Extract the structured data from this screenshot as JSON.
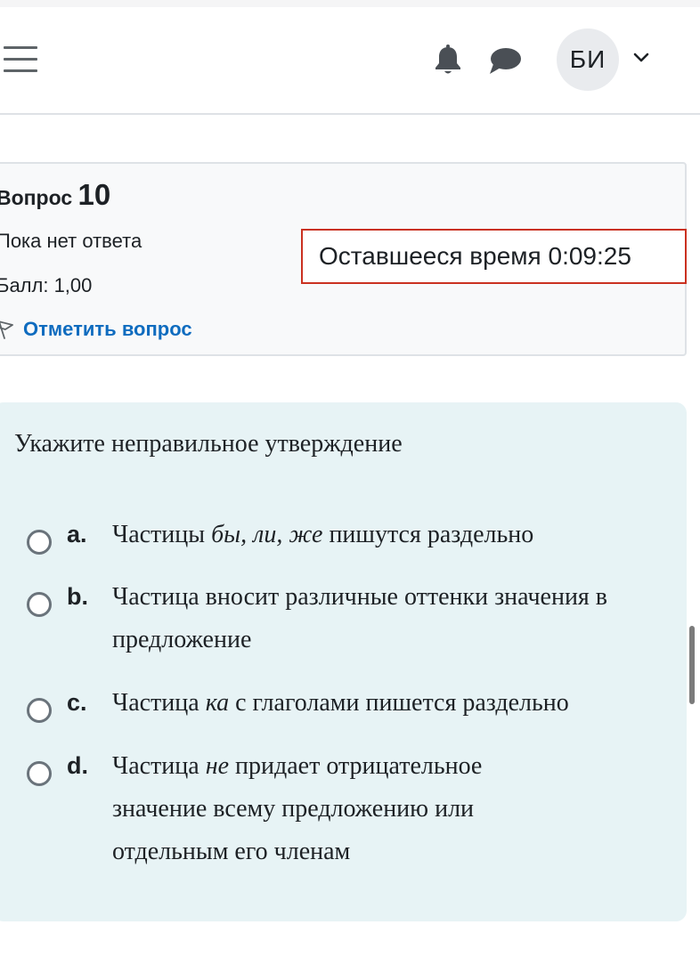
{
  "header": {
    "menu_icon": "hamburger-icon",
    "notifications_icon": "bell-icon",
    "messages_icon": "chat-bubble-icon",
    "user_initials": "БИ",
    "user_menu_icon": "chevron-down-icon"
  },
  "question_info": {
    "title_prefix": "Вопрос",
    "number": "10",
    "status": "Пока нет ответа",
    "grade": "Балл: 1,00",
    "flag_icon": "flag-outline-icon",
    "flag_label": "Отметить вопрос"
  },
  "timer": {
    "label": "Оставшееся время",
    "value": "0:09:25",
    "border_color": "#ca3120"
  },
  "question": {
    "prompt": "Укажите неправильное утверждение",
    "answers": [
      {
        "letter": "a.",
        "text_before": "Частицы ",
        "italic": "бы, ли, же",
        "text_after": " пишутся раздельно",
        "selected": false
      },
      {
        "letter": "b.",
        "text_before": "Частица вносит различные оттенки значения в предложение",
        "italic": "",
        "text_after": "",
        "selected": false
      },
      {
        "letter": "c.",
        "text_before": "Частица ",
        "italic": "ка",
        "text_after": " с глаголами пишется раздельно",
        "selected": false
      },
      {
        "letter": "d.",
        "text_before": "Частица ",
        "italic": "не",
        "text_after": " придает отрицательное значение всему предложению или отдельным его членам",
        "selected": false
      }
    ]
  },
  "colors": {
    "link": "#0f6cbf",
    "question_bg": "#e7f3f5",
    "info_bg": "#f8f9fa"
  }
}
